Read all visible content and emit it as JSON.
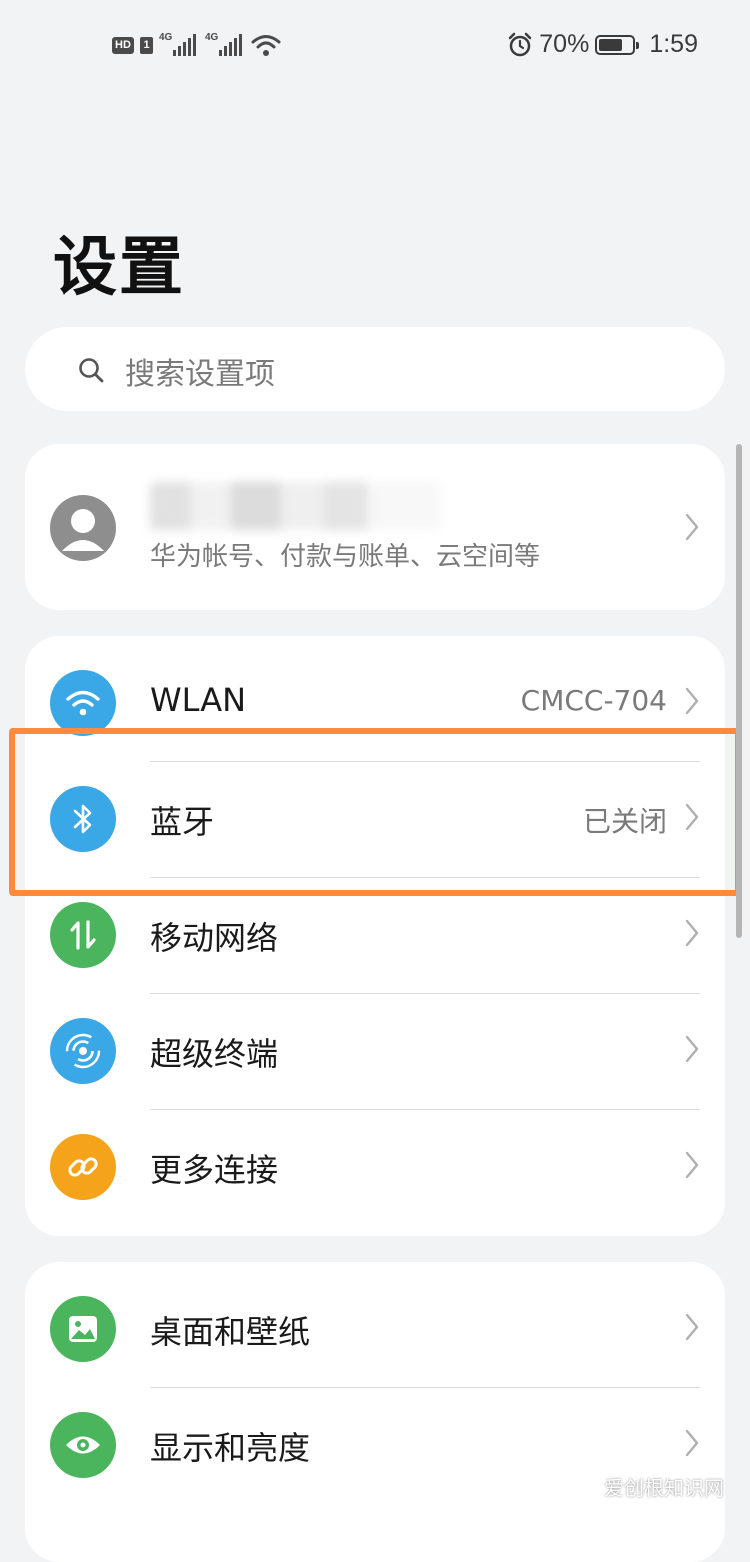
{
  "status_bar": {
    "hd_label": "HD",
    "sim_label": "1",
    "network_1": "4G",
    "network_2": "4G",
    "battery_percent": "70%",
    "battery_level": 0.7,
    "time": "1:59"
  },
  "title": "设置",
  "search": {
    "placeholder": "搜索设置项"
  },
  "account": {
    "subtitle": "华为帐号、付款与账单、云空间等"
  },
  "connect_items": [
    {
      "label": "WLAN",
      "value": "CMCC-704",
      "icon": "wifi-icon",
      "color": "#3aa7e6"
    },
    {
      "label": "蓝牙",
      "value": "已关闭",
      "icon": "bluetooth-icon",
      "color": "#3aa7e6"
    },
    {
      "label": "移动网络",
      "value": "",
      "icon": "mobile-data-icon",
      "color": "#4bb55e"
    },
    {
      "label": "超级终端",
      "value": "",
      "icon": "super-device-icon",
      "color": "#3aa7e6"
    },
    {
      "label": "更多连接",
      "value": "",
      "icon": "link-icon",
      "color": "#f5a31a"
    }
  ],
  "display_items": [
    {
      "label": "桌面和壁纸",
      "icon": "wallpaper-icon",
      "color": "#4bb55e"
    },
    {
      "label": "显示和亮度",
      "icon": "eye-icon",
      "color": "#4bb55e"
    }
  ],
  "watermark": "爱创根知识网",
  "colors": {
    "highlight": "#ff8a3d",
    "page_bg": "#f1f3f5"
  }
}
